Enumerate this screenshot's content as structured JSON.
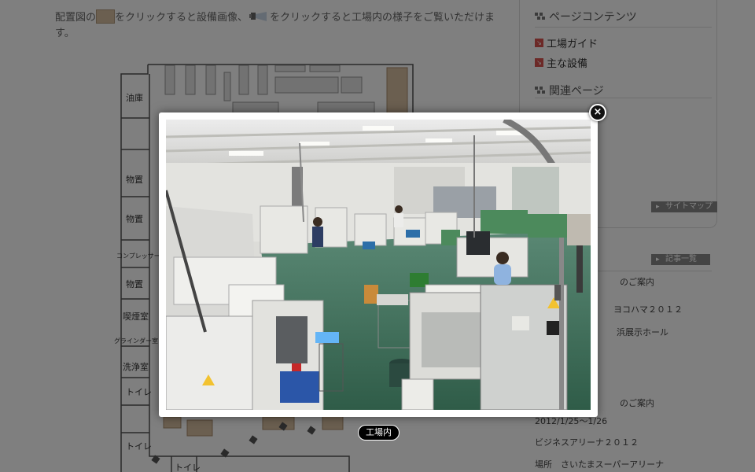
{
  "intro": {
    "part1": "配置図の",
    "part2": "をクリックすると設備画像、",
    "part3": "をクリックすると工場内の様子をご覧いただけます。"
  },
  "floorplan": {
    "rooms": [
      "油庫",
      "物置",
      "物置",
      "コンプレッサー室",
      "物置",
      "喫煙室",
      "グラインダー室",
      "洗浄室",
      "トイレ",
      "トイレ",
      "トイレ"
    ]
  },
  "sidebar": {
    "page_contents_heading": "ページコンテンツ",
    "links": [
      "工場ガイド",
      "主な設備"
    ],
    "related_heading": "関連ページ",
    "sitemap_button": "サイトマップ",
    "articles_button": "記事一覧",
    "news": [
      "のご案内",
      "ヨコハマ２０１２",
      "浜展示ホール",
      "のご案内",
      "2012/1/25～1/26",
      "ビジネスアリーナ２０１２",
      "場所　さいたまスーパーアリーナ"
    ]
  },
  "lightbox": {
    "caption": "工場内",
    "close_label": "×"
  },
  "colors": {
    "equipment_swatch": "#d7bfa1",
    "overlay": "rgba(0,0,0,0.5)",
    "factory_floor": "#3f6e58"
  }
}
